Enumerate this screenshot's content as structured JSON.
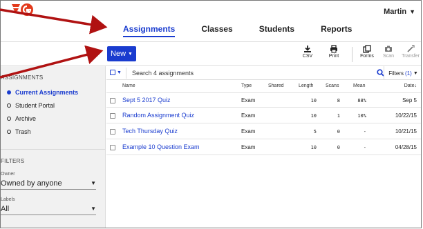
{
  "app": {
    "user_name": "Martin",
    "accent": "#1a3ccf",
    "logo_color": "#e33a1c"
  },
  "nav": {
    "tabs": [
      {
        "label": "Assignments",
        "active": true
      },
      {
        "label": "Classes"
      },
      {
        "label": "Students"
      },
      {
        "label": "Reports"
      }
    ]
  },
  "toolbar": {
    "new_label": "New",
    "tools": [
      {
        "label": "CSV",
        "icon": "download-icon"
      },
      {
        "label": "Print",
        "icon": "print-icon"
      },
      {
        "label": "Forms",
        "icon": "forms-icon"
      },
      {
        "label": "Scan",
        "icon": "camera-icon",
        "disabled": true
      },
      {
        "label": "Transfer",
        "icon": "transfer-icon",
        "disabled": true
      }
    ]
  },
  "sidebar": {
    "assignments_heading": "ASSIGNMENTS",
    "items": [
      {
        "label": "Current Assignments",
        "active": true
      },
      {
        "label": "Student Portal"
      },
      {
        "label": "Archive"
      },
      {
        "label": "Trash"
      }
    ],
    "filters_heading": "FILTERS",
    "owner_label": "Owner",
    "owner_value": "Owned by anyone",
    "labels_label": "Labels",
    "labels_value": "All"
  },
  "list": {
    "search_placeholder": "Search 4 assignments",
    "filters_label": "Filters",
    "filters_count": "(1)",
    "columns": {
      "name": "Name",
      "type": "Type",
      "shared": "Shared",
      "length": "Length",
      "scans": "Scans",
      "mean": "Mean",
      "date": "Date"
    },
    "sort_indicator": "↓",
    "rows": [
      {
        "name": "Sept 5 2017 Quiz",
        "type": "Exam",
        "shared": "",
        "length": "10",
        "scans": "8",
        "mean": "88%",
        "date": "Sep 5"
      },
      {
        "name": "Random Assignment Quiz",
        "type": "Exam",
        "shared": "",
        "length": "10",
        "scans": "1",
        "mean": "10%",
        "date": "10/22/15"
      },
      {
        "name": "Tech Thursday Quiz",
        "type": "Exam",
        "shared": "",
        "length": "5",
        "scans": "0",
        "mean": "-",
        "date": "10/21/15"
      },
      {
        "name": "Example 10 Question Exam",
        "type": "Exam",
        "shared": "",
        "length": "10",
        "scans": "0",
        "mean": "-",
        "date": "04/28/15"
      }
    ]
  }
}
